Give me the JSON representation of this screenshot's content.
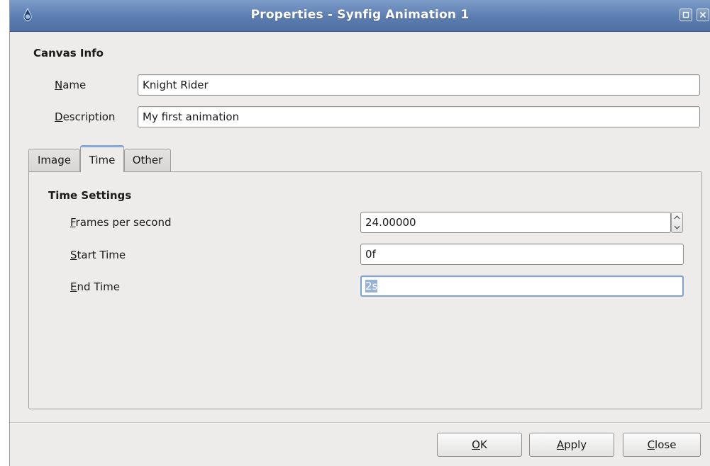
{
  "window": {
    "title": "Properties - Synfig Animation 1",
    "titlebar_color": "#5b7db0"
  },
  "canvas_info": {
    "heading": "Canvas Info",
    "name_label": {
      "mnemonic": "N",
      "rest": "ame"
    },
    "name_value": "Knight Rider",
    "description_label": {
      "mnemonic": "D",
      "rest": "escription"
    },
    "description_value": "My first animation"
  },
  "tabs": [
    {
      "label": "Image",
      "active": false
    },
    {
      "label": "Time",
      "active": true
    },
    {
      "label": "Other",
      "active": false
    }
  ],
  "time_settings": {
    "heading": "Time Settings",
    "fps_label": {
      "mnemonic": "F",
      "rest": "rames per second"
    },
    "fps_value": "24.00000",
    "start_label": {
      "mnemonic": "S",
      "rest": "tart Time"
    },
    "start_value": "0f",
    "end_label": {
      "mnemonic": "E",
      "rest": "nd Time"
    },
    "end_value": "2s"
  },
  "buttons": {
    "ok": {
      "mnemonic": "O",
      "rest": "K"
    },
    "apply": {
      "mnemonic": "A",
      "rest": "pply"
    },
    "close": {
      "mnemonic": "C",
      "rest": "lose"
    }
  },
  "colors": {
    "selection": "#97b1d8",
    "focus_ring": "#7fa2d3",
    "active_tab_accent": "#86a8d6"
  },
  "icons": {
    "app": "synfig-app-icon",
    "maximize": "maximize-icon",
    "close": "close-icon",
    "spin_up": "spin-up-icon",
    "spin_down": "spin-down-icon"
  }
}
